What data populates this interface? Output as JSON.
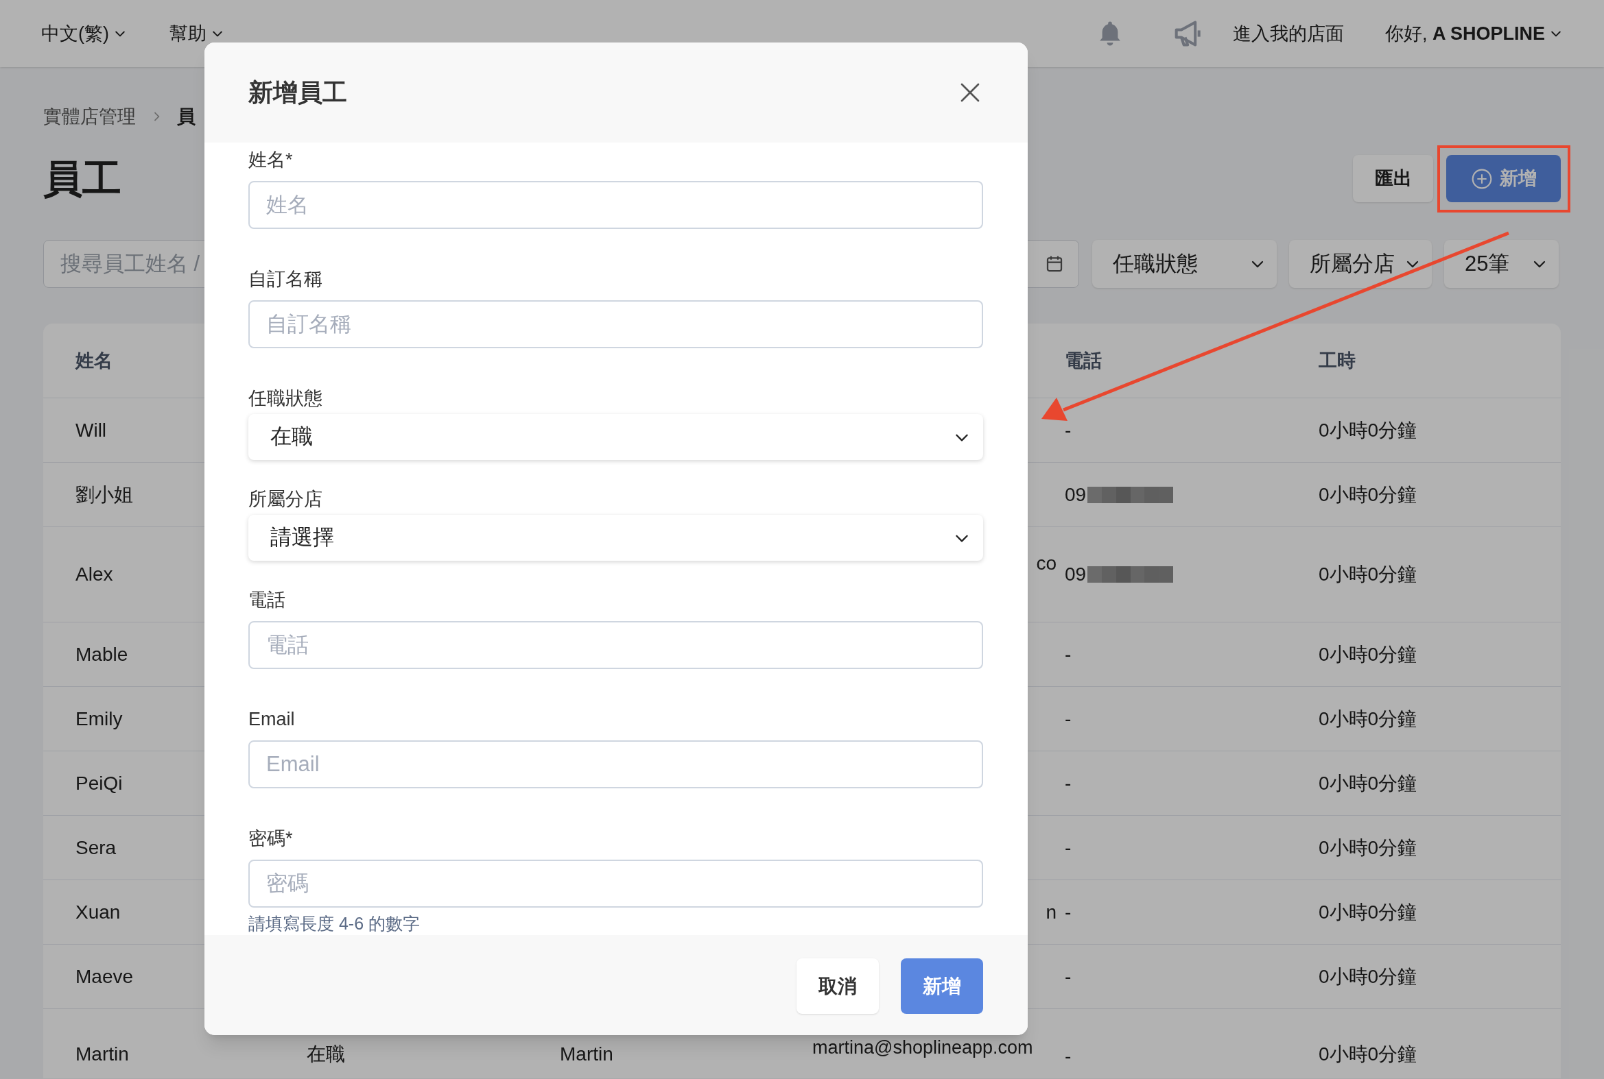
{
  "top_bar": {
    "menus": [
      {
        "label": "中文(繁)"
      },
      {
        "label": "幫助"
      }
    ],
    "store_link": "進入我的店面",
    "greeting": "你好, **A SHOPLINE**"
  },
  "breadcrumb": [
    {
      "label": "實體店管理"
    },
    {
      "label": "員"
    }
  ],
  "page_title": "員工",
  "actions": [
    {
      "label": "匯出",
      "kind": "secondary"
    },
    {
      "label": "新增",
      "kind": "primary"
    }
  ],
  "filters": {
    "search_placeholder": "搜尋員工姓名 /",
    "dropdowns": [
      {
        "label": "任職狀態"
      },
      {
        "label": "所屬分店"
      },
      {
        "label": "25筆"
      }
    ]
  },
  "table": {
    "columns": [
      "姓名",
      "電話",
      "工時"
    ],
    "rows": [
      {
        "name": "Will",
        "phone": "-",
        "hours": "0小時0分鐘"
      },
      {
        "name": "劉小姐",
        "phone": "09",
        "redacted": true,
        "hours": "0小時0分鐘"
      },
      {
        "name": "Alex",
        "email_tail": "co",
        "phone": "09",
        "redacted": true,
        "hours": "0小時0分鐘"
      },
      {
        "name": "Mable",
        "phone": "-",
        "hours": "0小時0分鐘"
      },
      {
        "name": "Emily",
        "phone": "-",
        "hours": "0小時0分鐘"
      },
      {
        "name": "PeiQi",
        "phone": "-",
        "hours": "0小時0分鐘"
      },
      {
        "name": "Sera",
        "phone": "-",
        "hours": "0小時0分鐘"
      },
      {
        "name": "Xuan",
        "email_tail": "n",
        "phone": "-",
        "hours": "0小時0分鐘"
      },
      {
        "name": "Maeve",
        "phone": "-",
        "hours": "0小時0分鐘"
      },
      {
        "name": "Martin",
        "status": "在職",
        "custom_name": "Martin",
        "email": "martina@shoplineapp.com",
        "phone": "-",
        "hours": "0小時0分鐘"
      }
    ]
  },
  "dialog": {
    "title": "新增員工",
    "fields": [
      {
        "label": "姓名*",
        "kind": "input",
        "placeholder": "姓名"
      },
      {
        "label": "自訂名稱",
        "kind": "input",
        "placeholder": "自訂名稱"
      },
      {
        "label": "任職狀態",
        "kind": "select",
        "value": "在職"
      },
      {
        "label": "所屬分店",
        "kind": "select",
        "value": "請選擇"
      },
      {
        "label": "電話",
        "kind": "input",
        "placeholder": "電話"
      },
      {
        "label": "Email",
        "kind": "input",
        "placeholder": "Email"
      },
      {
        "label": "密碼*",
        "kind": "input",
        "placeholder": "密碼",
        "hint": "請填寫長度 4-6 的數字"
      }
    ],
    "buttons": [
      {
        "label": "取消",
        "kind": "secondary"
      },
      {
        "label": "新增",
        "kind": "primary"
      }
    ]
  }
}
